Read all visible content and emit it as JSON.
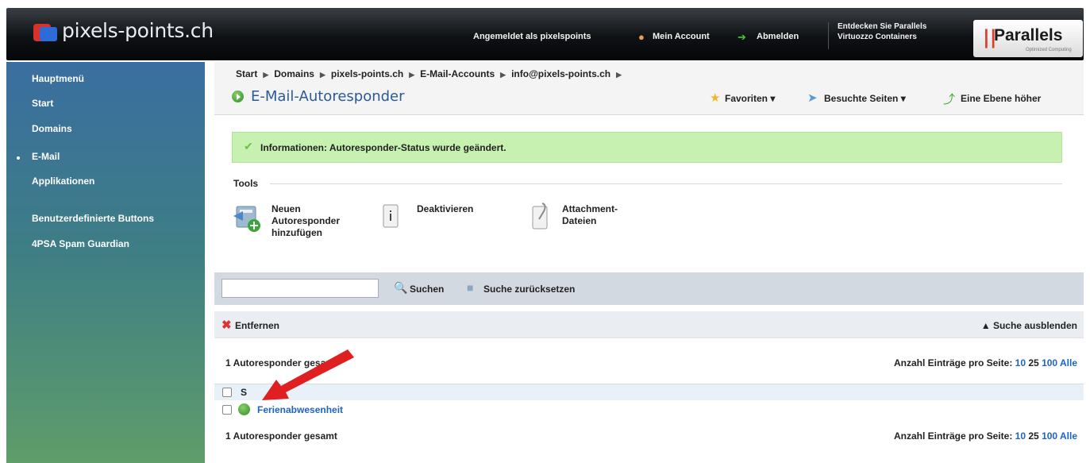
{
  "header": {
    "brand": "pixels-points.ch",
    "logged_in": "Angemeldet als pixelspoints",
    "account": "Mein Account",
    "logout": "Abmelden",
    "promo_line1": "Entdecken Sie Parallels",
    "promo_line2": "Virtuozzo Containers",
    "parallels_logo": "Parallels",
    "parallels_sub": "Optimized Computing"
  },
  "sidebar": {
    "items": [
      {
        "label": "Hauptmenü"
      },
      {
        "label": "Start"
      },
      {
        "label": "Domains"
      },
      {
        "label": "E-Mail"
      },
      {
        "label": "Applikationen"
      },
      {
        "label": "Benutzerdefinierte Buttons"
      },
      {
        "label": "4PSA Spam Guardian"
      }
    ]
  },
  "breadcrumb": [
    "Start",
    "Domains",
    "pixels-points.ch",
    "E-Mail-Accounts",
    "info@pixels-points.ch"
  ],
  "page": {
    "title": "E-Mail-Autoresponder",
    "favorites": "Favoriten",
    "visited": "Besuchte Seiten",
    "level_up": "Eine Ebene höher"
  },
  "info": {
    "message": "Informationen: Autoresponder-Status wurde geändert."
  },
  "tools": {
    "title": "Tools",
    "new_line1": "Neuen",
    "new_line2": "Autoresponder",
    "new_line3": "hinzufügen",
    "deactivate": "Deaktivieren",
    "attach_line1": "Attachment-",
    "attach_line2": "Dateien"
  },
  "search": {
    "value": "",
    "search_label": "Suchen",
    "reset_label": "Suche zurücksetzen"
  },
  "list": {
    "remove": "Entfernen",
    "hide_search": "Suche ausblenden",
    "total_top": "1 Autoresponder gesamt",
    "total_bottom": "1 Autoresponder gesamt",
    "per_page_label": "Anzahl Einträge pro Seite:",
    "page_sizes": [
      "10",
      "25",
      "100",
      "Alle"
    ],
    "col_s": "S",
    "rows": [
      {
        "name": "Ferienabwesenheit"
      }
    ]
  },
  "colors": {
    "sidebar_top": "#3a6ea0",
    "info_bg": "#c6f1b0",
    "link": "#1e63c6",
    "annotation_arrow": "#e02020"
  },
  "icons": {
    "logo": "pixels-points-logo-icon",
    "account": "user-icon",
    "logout": "green-arrow-icon",
    "favorites": "star-icon",
    "visited": "arrow-icon",
    "level_up": "green-up-arrow-icon"
  }
}
